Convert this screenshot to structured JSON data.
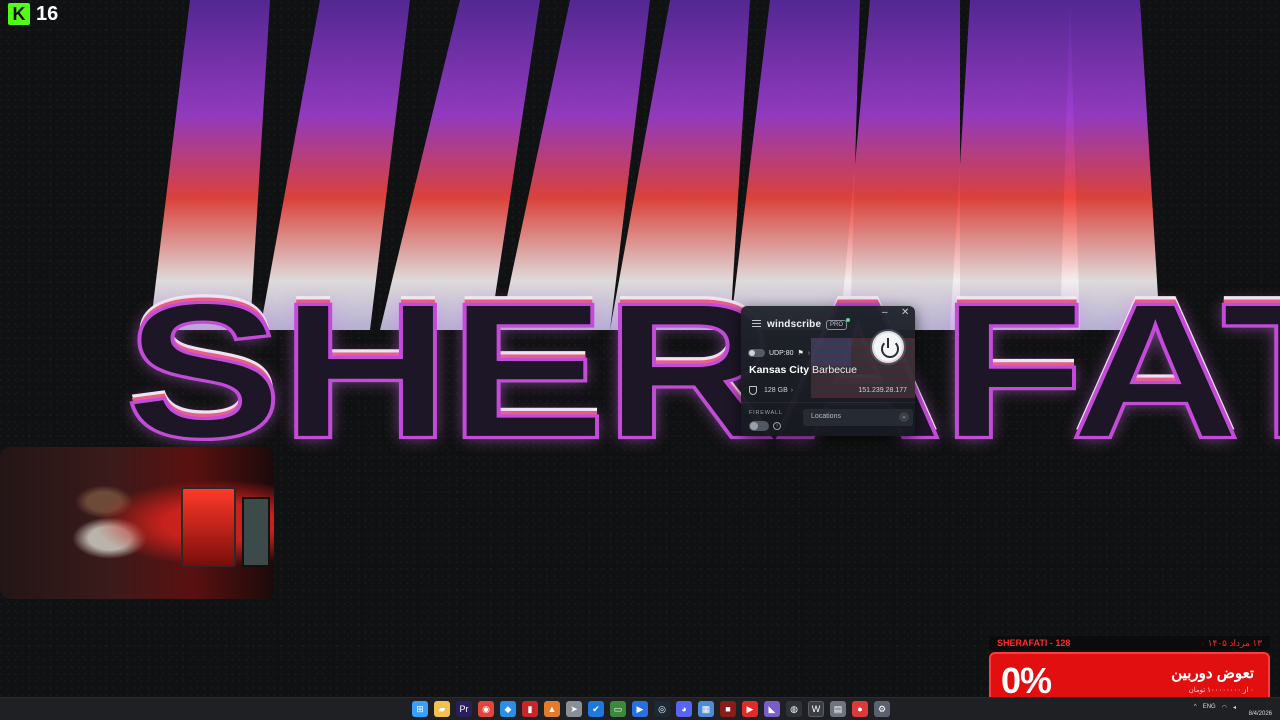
{
  "stream": {
    "platform_icon": "kick-logo-icon",
    "viewer_count": "16"
  },
  "wallpaper": {
    "title_text": "SHERAFATI",
    "colors": {
      "purple": "#8a3bd6",
      "red": "#f0473f",
      "white": "#f5f5f5",
      "dark": "#1d1626"
    }
  },
  "windscribe": {
    "app_name": "windscribe",
    "plan_badge": "PRO",
    "protocol": "UDP:80",
    "city": "Kansas City",
    "nickname": "Barbecue",
    "data_remaining": "128 GB",
    "ip_address": "151.239.28.177",
    "firewall_label": "FIREWALL",
    "locations_label": "Locations",
    "status_dot_color": "#55e08a",
    "accent": "#f4f5f7"
  },
  "alert": {
    "name": "SHERAFATI - 128",
    "date": "۱۳ مرداد ۱۴۰۵",
    "percent": "0%",
    "title": "تعوض دوربین",
    "subtitle": "۰ از ۱۰۰۰۰۰۰۰۰ تومان",
    "color": "#e10f0f"
  },
  "taskbar": {
    "tray_lang": "ENG",
    "date": "8/4/2026",
    "icons": [
      "windows-start-icon",
      "file-explorer-icon",
      "premiere-icon",
      "chrome-icon",
      "vscode-icon",
      "red-app-icon",
      "office-icon",
      "cursor-icon",
      "check-app-icon",
      "terminal-icon",
      "media-app-icon",
      "steam-icon",
      "discord-icon",
      "calculator-icon",
      "red-square-icon",
      "youtube-icon",
      "visual-studio-icon",
      "obs-icon",
      "windscribe-icon",
      "notepad-icon",
      "record-app-icon",
      "settings-icon"
    ]
  }
}
